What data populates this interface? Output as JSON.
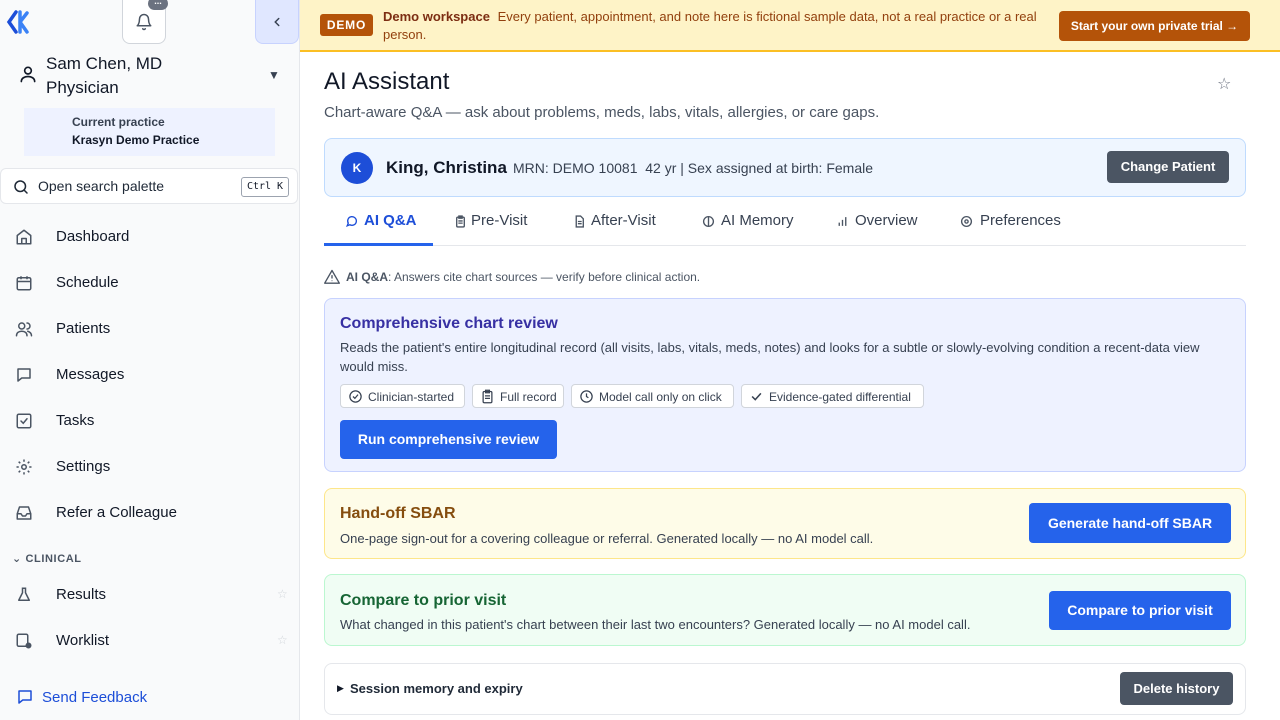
{
  "sidebar": {
    "notification_badge": "...",
    "user": {
      "name": "Sam Chen, MD",
      "role": "Physician"
    },
    "practice": {
      "label": "Current practice",
      "name": "Krasyn Demo Practice"
    },
    "search": {
      "placeholder": "Open search palette",
      "shortcut": "Ctrl K"
    },
    "nav": [
      {
        "label": "Dashboard",
        "icon": "home-icon"
      },
      {
        "label": "Schedule",
        "icon": "calendar-icon"
      },
      {
        "label": "Patients",
        "icon": "users-icon"
      },
      {
        "label": "Messages",
        "icon": "message-icon"
      },
      {
        "label": "Tasks",
        "icon": "checkbox-icon"
      },
      {
        "label": "Settings",
        "icon": "gear-icon"
      },
      {
        "label": "Refer a Colleague",
        "icon": "inbox-icon"
      }
    ],
    "section_clinical": "CLINICAL",
    "clinical": [
      {
        "label": "Results",
        "icon": "flask-icon"
      },
      {
        "label": "Worklist",
        "icon": "worklist-icon"
      }
    ],
    "feedback": "Send Feedback"
  },
  "banner": {
    "pill": "DEMO",
    "title": "Demo workspace",
    "text": "Every patient, appointment, and note here is fictional sample data, not a real practice or a real person.",
    "cta": "Start your own private trial →"
  },
  "page": {
    "title": "AI Assistant",
    "subtitle": "Chart-aware Q&A — ask about problems, meds, labs, vitals, allergies, or care gaps."
  },
  "patient": {
    "initial": "K",
    "name": "King, Christina",
    "meta": "MRN: DEMO 10081  42 yr | Sex assigned at birth: Female",
    "change_label": "Change Patient"
  },
  "tabs": [
    {
      "label": "AI Q&A",
      "active": true
    },
    {
      "label": "Pre-Visit"
    },
    {
      "label": "After-Visit"
    },
    {
      "label": "AI Memory"
    },
    {
      "label": "Overview"
    },
    {
      "label": "Preferences"
    }
  ],
  "note": {
    "bold": "AI Q&A",
    "text": ": Answers cite chart sources — verify before clinical action."
  },
  "review": {
    "title": "Comprehensive chart review",
    "desc": "Reads the patient's entire longitudinal record (all visits, labs, vitals, meds, notes) and looks for a subtle or slowly-evolving condition a recent-data view would miss.",
    "chips": [
      "Clinician-started",
      "Full record",
      "Model call only on click",
      "Evidence-gated differential"
    ],
    "button": "Run comprehensive review"
  },
  "sbar": {
    "title": "Hand-off SBAR",
    "desc": "One-page sign-out for a covering colleague or referral. Generated locally — no AI model call.",
    "button": "Generate hand-off SBAR"
  },
  "compare": {
    "title": "Compare to prior visit",
    "desc": "What changed in this patient's chart between their last two encounters? Generated locally — no AI model call.",
    "button": "Compare to prior visit"
  },
  "session": {
    "label": "Session memory and expiry",
    "button": "Delete history"
  }
}
